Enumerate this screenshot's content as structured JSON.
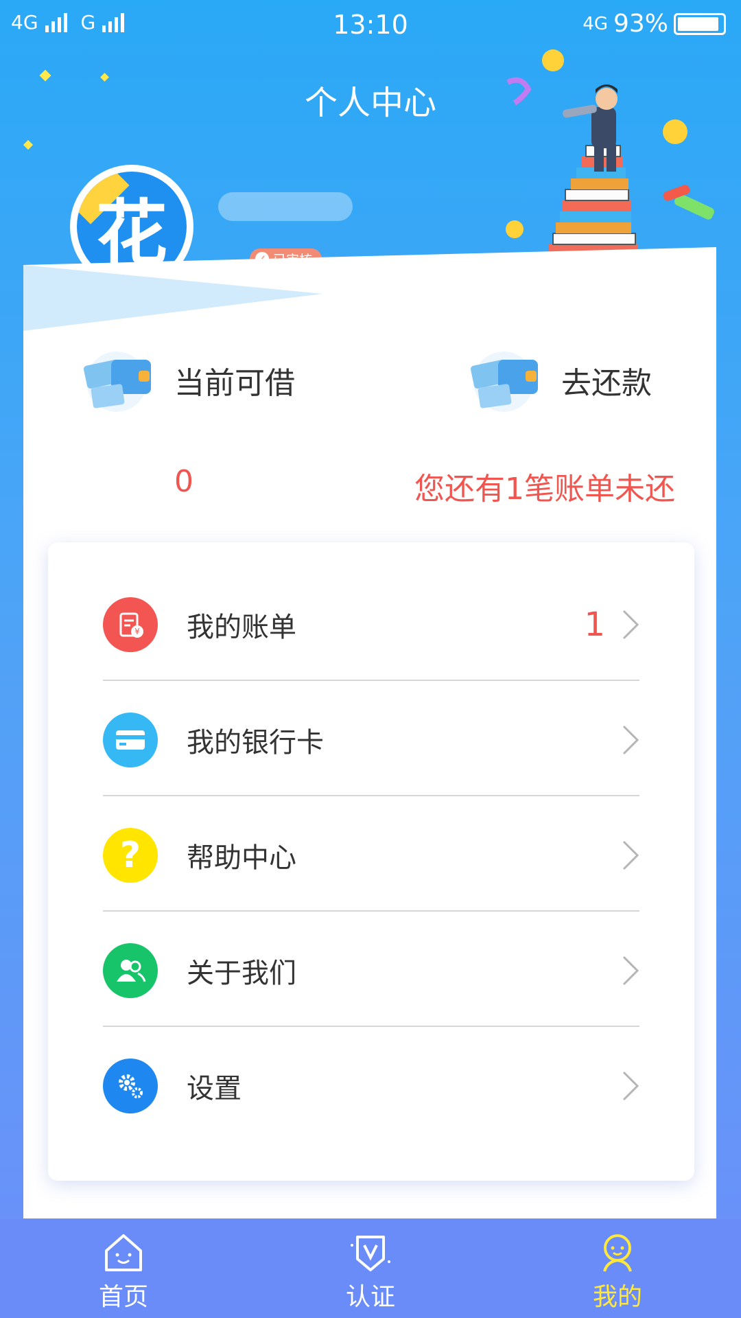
{
  "status_bar": {
    "network_left": "4G",
    "network_second": "G",
    "time": "13:10",
    "network_right": "4G",
    "battery": "93%"
  },
  "header": {
    "title": "个人中心"
  },
  "profile": {
    "avatar_char": "花",
    "verified_badge": "已审核"
  },
  "summary": {
    "borrow_label": "当前可借",
    "borrow_value": "0",
    "repay_label": "去还款",
    "repay_value": "您还有1笔账单未还"
  },
  "menu": [
    {
      "label": "我的账单",
      "count": "1",
      "icon": "bill-icon",
      "color": "#f25552"
    },
    {
      "label": "我的银行卡",
      "count": "",
      "icon": "bank-card-icon",
      "color": "#35b8f4"
    },
    {
      "label": "帮助中心",
      "count": "",
      "icon": "question-icon",
      "color": "#ffe500"
    },
    {
      "label": "关于我们",
      "count": "",
      "icon": "users-icon",
      "color": "#18c46a"
    },
    {
      "label": "设置",
      "count": "",
      "icon": "gear-icon",
      "color": "#1e88f0"
    }
  ],
  "tabbar": {
    "tabs": [
      {
        "label": "首页",
        "icon": "home-icon"
      },
      {
        "label": "认证",
        "icon": "verify-icon"
      },
      {
        "label": "我的",
        "icon": "profile-icon"
      }
    ],
    "active_color": "#ffe83a"
  }
}
